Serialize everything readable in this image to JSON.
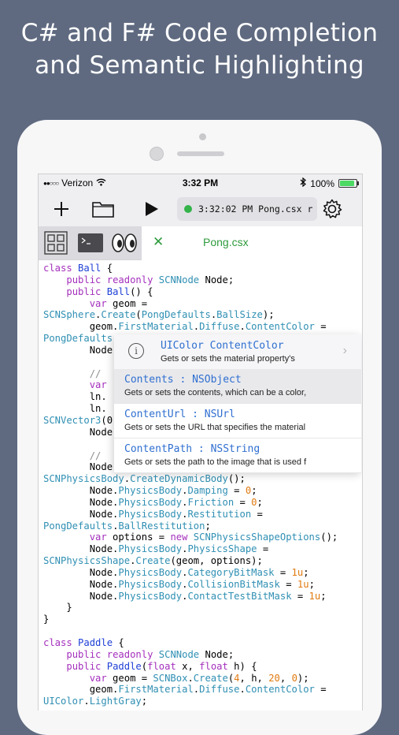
{
  "headline": {
    "line1": "C# and F# Code Completion",
    "line2": "and Semantic Highlighting"
  },
  "status_bar": {
    "carrier": "Verizon",
    "signal_dots": "●●○○○",
    "time": "3:32 PM",
    "battery_percent": "100%",
    "battery_level": 1.0
  },
  "toolbar": {
    "icons": [
      "plus-icon",
      "folder-icon",
      "play-icon",
      "gear-icon"
    ],
    "run_status": "3:32:02 PM Pong.csx r"
  },
  "tabs": {
    "icons": [
      "grid-icon",
      "terminal-icon",
      "eyes-icon"
    ],
    "close_glyph": "✕",
    "active_title": "Pong.csx"
  },
  "code_lines": [
    [
      [
        "k",
        "class"
      ],
      [
        "p",
        " "
      ],
      [
        "d",
        "Ball"
      ],
      [
        "p",
        " {"
      ]
    ],
    [
      [
        "p",
        "    "
      ],
      [
        "k",
        "public"
      ],
      [
        "p",
        " "
      ],
      [
        "k",
        "readonly"
      ],
      [
        "p",
        " "
      ],
      [
        "t",
        "SCNNode"
      ],
      [
        "p",
        " Node;"
      ]
    ],
    [
      [
        "p",
        "    "
      ],
      [
        "k",
        "public"
      ],
      [
        "p",
        " "
      ],
      [
        "d",
        "Ball"
      ],
      [
        "p",
        "() {"
      ]
    ],
    [
      [
        "p",
        "        "
      ],
      [
        "k",
        "var"
      ],
      [
        "p",
        " geom ="
      ]
    ],
    [
      [
        "t",
        "SCNSphere"
      ],
      [
        "p",
        "."
      ],
      [
        "t",
        "Create"
      ],
      [
        "p",
        "("
      ],
      [
        "t",
        "PongDefaults"
      ],
      [
        "p",
        "."
      ],
      [
        "t",
        "BallSize"
      ],
      [
        "p",
        ");"
      ]
    ],
    [
      [
        "p",
        "        geom."
      ],
      [
        "t",
        "FirstMaterial"
      ],
      [
        "p",
        "."
      ],
      [
        "t",
        "Diffuse"
      ],
      [
        "p",
        "."
      ],
      [
        "t",
        "ContentColor"
      ],
      [
        "p",
        " ="
      ]
    ],
    [
      [
        "t",
        "PongDefaults"
      ],
      [
        "p",
        "."
      ]
    ],
    [
      [
        "p",
        "        Node"
      ]
    ],
    [
      [
        "p",
        ""
      ]
    ],
    [
      [
        "p",
        "        "
      ],
      [
        "c",
        "// "
      ]
    ],
    [
      [
        "p",
        "        "
      ],
      [
        "k",
        "var"
      ]
    ],
    [
      [
        "p",
        "        ln."
      ]
    ],
    [
      [
        "p",
        "        ln."
      ]
    ],
    [
      [
        "t",
        "SCNVector3"
      ],
      [
        "p",
        "(0"
      ]
    ],
    [
      [
        "p",
        "        Node"
      ]
    ],
    [
      [
        "p",
        ""
      ]
    ],
    [
      [
        "p",
        "        "
      ],
      [
        "c",
        "// "
      ]
    ],
    [
      [
        "p",
        "        Node."
      ],
      [
        "t",
        "PhysicsBody"
      ],
      [
        "p",
        " ="
      ]
    ],
    [
      [
        "t",
        "SCNPhysicsBody"
      ],
      [
        "p",
        "."
      ],
      [
        "t",
        "CreateDynamicBody"
      ],
      [
        "p",
        "();"
      ]
    ],
    [
      [
        "p",
        "        Node."
      ],
      [
        "t",
        "PhysicsBody"
      ],
      [
        "p",
        "."
      ],
      [
        "t",
        "Damping"
      ],
      [
        "p",
        " = "
      ],
      [
        "n",
        "0"
      ],
      [
        "p",
        ";"
      ]
    ],
    [
      [
        "p",
        "        Node."
      ],
      [
        "t",
        "PhysicsBody"
      ],
      [
        "p",
        "."
      ],
      [
        "t",
        "Friction"
      ],
      [
        "p",
        " = "
      ],
      [
        "n",
        "0"
      ],
      [
        "p",
        ";"
      ]
    ],
    [
      [
        "p",
        "        Node."
      ],
      [
        "t",
        "PhysicsBody"
      ],
      [
        "p",
        "."
      ],
      [
        "t",
        "Restitution"
      ],
      [
        "p",
        " ="
      ]
    ],
    [
      [
        "t",
        "PongDefaults"
      ],
      [
        "p",
        "."
      ],
      [
        "t",
        "BallRestitution"
      ],
      [
        "p",
        ";"
      ]
    ],
    [
      [
        "p",
        "        "
      ],
      [
        "k",
        "var"
      ],
      [
        "p",
        " options = "
      ],
      [
        "k",
        "new"
      ],
      [
        "p",
        " "
      ],
      [
        "t",
        "SCNPhysicsShapeOptions"
      ],
      [
        "p",
        "();"
      ]
    ],
    [
      [
        "p",
        "        Node."
      ],
      [
        "t",
        "PhysicsBody"
      ],
      [
        "p",
        "."
      ],
      [
        "t",
        "PhysicsShape"
      ],
      [
        "p",
        " ="
      ]
    ],
    [
      [
        "t",
        "SCNPhysicsShape"
      ],
      [
        "p",
        "."
      ],
      [
        "t",
        "Create"
      ],
      [
        "p",
        "(geom, options);"
      ]
    ],
    [
      [
        "p",
        "        Node."
      ],
      [
        "t",
        "PhysicsBody"
      ],
      [
        "p",
        "."
      ],
      [
        "t",
        "CategoryBitMask"
      ],
      [
        "p",
        " = "
      ],
      [
        "n",
        "1u"
      ],
      [
        "p",
        ";"
      ]
    ],
    [
      [
        "p",
        "        Node."
      ],
      [
        "t",
        "PhysicsBody"
      ],
      [
        "p",
        "."
      ],
      [
        "t",
        "CollisionBitMask"
      ],
      [
        "p",
        " = "
      ],
      [
        "n",
        "1u"
      ],
      [
        "p",
        ";"
      ]
    ],
    [
      [
        "p",
        "        Node."
      ],
      [
        "t",
        "PhysicsBody"
      ],
      [
        "p",
        "."
      ],
      [
        "t",
        "ContactTestBitMask"
      ],
      [
        "p",
        " = "
      ],
      [
        "n",
        "1u"
      ],
      [
        "p",
        ";"
      ]
    ],
    [
      [
        "p",
        "    }"
      ]
    ],
    [
      [
        "p",
        "}"
      ]
    ],
    [
      [
        "p",
        ""
      ]
    ],
    [
      [
        "k",
        "class"
      ],
      [
        "p",
        " "
      ],
      [
        "d",
        "Paddle"
      ],
      [
        "p",
        " {"
      ]
    ],
    [
      [
        "p",
        "    "
      ],
      [
        "k",
        "public"
      ],
      [
        "p",
        " "
      ],
      [
        "k",
        "readonly"
      ],
      [
        "p",
        " "
      ],
      [
        "t",
        "SCNNode"
      ],
      [
        "p",
        " Node;"
      ]
    ],
    [
      [
        "p",
        "    "
      ],
      [
        "k",
        "public"
      ],
      [
        "p",
        " "
      ],
      [
        "d",
        "Paddle"
      ],
      [
        "p",
        "("
      ],
      [
        "k",
        "float"
      ],
      [
        "p",
        " x, "
      ],
      [
        "k",
        "float"
      ],
      [
        "p",
        " h) {"
      ]
    ],
    [
      [
        "p",
        "        "
      ],
      [
        "k",
        "var"
      ],
      [
        "p",
        " geom = "
      ],
      [
        "t",
        "SCNBox"
      ],
      [
        "p",
        "."
      ],
      [
        "t",
        "Create"
      ],
      [
        "p",
        "("
      ],
      [
        "n",
        "4"
      ],
      [
        "p",
        ", h, "
      ],
      [
        "n",
        "20"
      ],
      [
        "p",
        ", "
      ],
      [
        "n",
        "0"
      ],
      [
        "p",
        ");"
      ]
    ],
    [
      [
        "p",
        "        geom."
      ],
      [
        "t",
        "FirstMaterial"
      ],
      [
        "p",
        "."
      ],
      [
        "t",
        "Diffuse"
      ],
      [
        "p",
        "."
      ],
      [
        "t",
        "ContentColor"
      ],
      [
        "p",
        " ="
      ]
    ],
    [
      [
        "t",
        "UIColor"
      ],
      [
        "p",
        "."
      ],
      [
        "t",
        "LightGray"
      ],
      [
        "p",
        ";"
      ]
    ]
  ],
  "completion": {
    "header": {
      "icon": "info-icon",
      "title": "UIColor ContentColor",
      "description": "Gets or sets the material property's",
      "chevron": "›"
    },
    "items": [
      {
        "title": "Contents : NSObject",
        "description": "Gets or sets the contents, which can be a color,",
        "selected": true
      },
      {
        "title": "ContentUrl : NSUrl",
        "description": "Gets or sets the URL that specifies the material",
        "selected": false
      },
      {
        "title": "ContentPath : NSString",
        "description": "Gets or sets the path to the image that is used f",
        "selected": false
      }
    ]
  },
  "colors": {
    "background": "#5f6a80",
    "keyword": "#a42fbd",
    "type": "#2f8fb3",
    "number": "#e07a10",
    "declaration": "#1e3fd6",
    "accent_green": "#2e9b3c"
  }
}
